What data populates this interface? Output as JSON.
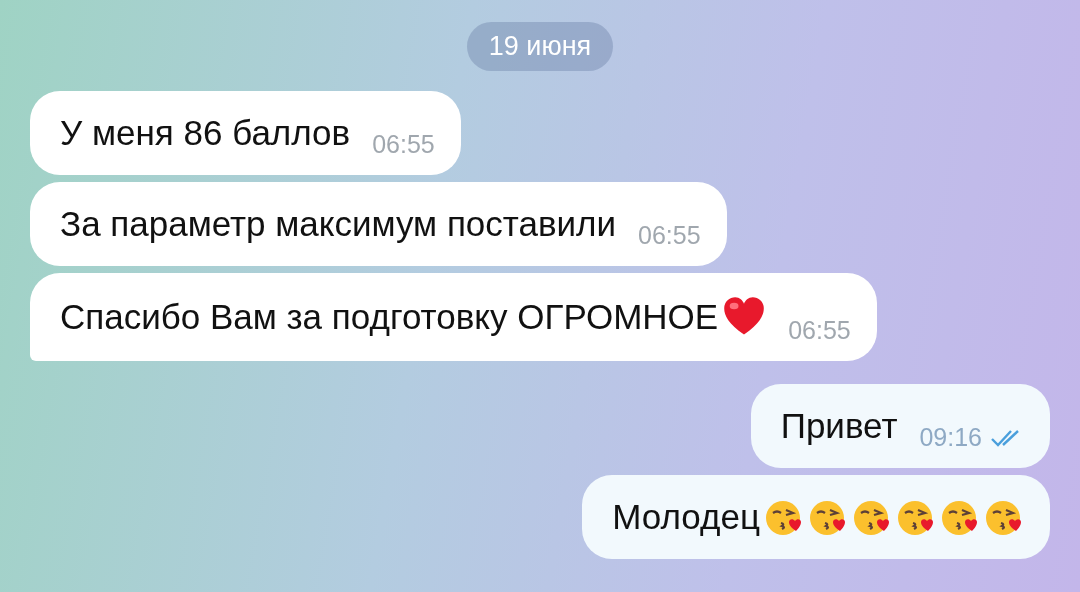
{
  "date_label": "19 июня",
  "messages": [
    {
      "kind": "incoming",
      "text": "У меня 86 баллов",
      "time": "06:55"
    },
    {
      "kind": "incoming",
      "text": "За параметр максимум поставили",
      "time": "06:55"
    },
    {
      "kind": "incoming",
      "text": "Спасибо Вам за подготовку ОГРОМНОЕ",
      "time": "06:55",
      "emojis": [
        {
          "kind": "heart"
        }
      ]
    },
    {
      "kind": "outgoing",
      "text": "Привет",
      "time": "09:16",
      "read": true
    },
    {
      "kind": "outgoing",
      "text": "Молодец",
      "emojis": [
        {
          "kind": "kiss"
        },
        {
          "kind": "kiss"
        },
        {
          "kind": "kiss"
        },
        {
          "kind": "kiss"
        },
        {
          "kind": "kiss"
        },
        {
          "kind": "kiss"
        }
      ]
    }
  ]
}
